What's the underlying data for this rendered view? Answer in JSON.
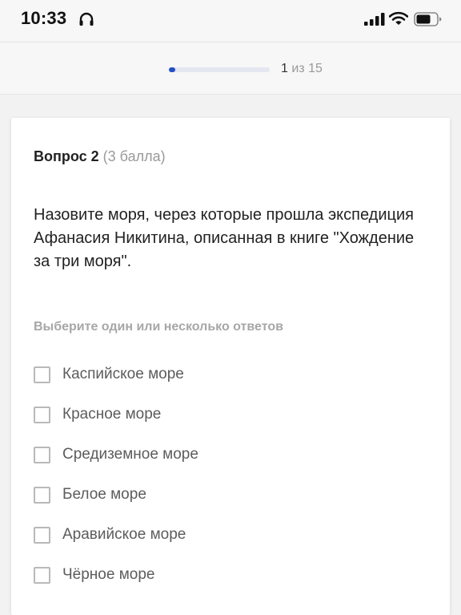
{
  "status_bar": {
    "time": "10:33",
    "icons": [
      "headphones-icon",
      "signal-icon",
      "wifi-icon",
      "battery-icon"
    ]
  },
  "progress": {
    "current": "1",
    "separator": "из",
    "total": "15",
    "fraction": 0.0667,
    "accent_color": "#2350c9"
  },
  "question": {
    "label": "Вопрос 2",
    "points": "(3 балла)",
    "text": "Назовите моря, через которые прошла экспедиция Афанасия Никитина, описанная в книге \"Хождение за три моря\".",
    "instruction": "Выберите один или несколько ответов",
    "options": [
      "Каспийское море",
      "Красное море",
      "Средиземное море",
      "Белое море",
      "Аравийское море",
      "Чёрное море"
    ]
  }
}
